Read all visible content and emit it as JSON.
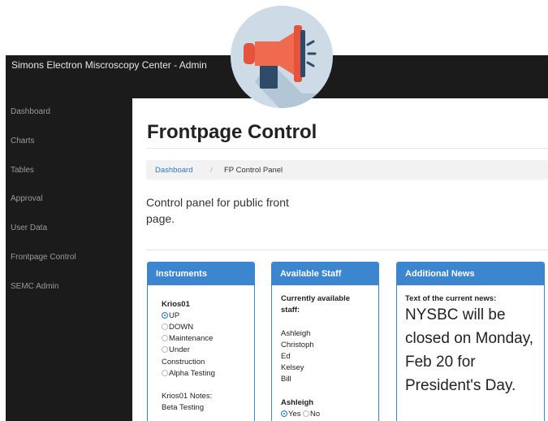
{
  "app": {
    "title": "Simons Electron Miscroscopy Center - Admin"
  },
  "logo": {
    "icon": "megaphone-icon",
    "colors": {
      "circle": "#cddbe6",
      "body": "#e5533d",
      "handle": "#2f4a66"
    }
  },
  "sidebar": {
    "items": [
      {
        "label": "Dashboard"
      },
      {
        "label": "Charts"
      },
      {
        "label": "Tables"
      },
      {
        "label": "Approval"
      },
      {
        "label": "User Data"
      },
      {
        "label": "Frontpage Control"
      },
      {
        "label": "SEMC Admin"
      }
    ]
  },
  "main": {
    "title": "Frontpage Control",
    "breadcrumb": {
      "link": "Dashboard",
      "separator": "/",
      "active": "FP Control Panel"
    },
    "lead": "Control panel for public front page."
  },
  "instruments": {
    "header": "Instruments",
    "instrument_name": "Krios01",
    "options": [
      "UP",
      "DOWN",
      "Maintenance",
      "Under",
      "Construction",
      "Alpha Testing"
    ],
    "selected": "UP",
    "notes_label": "Krios01 Notes:",
    "notes_value": "Beta Testing"
  },
  "staff": {
    "header": "Available Staff",
    "currently_label_line1": "Currently available",
    "currently_label_line2": "staff:",
    "names": [
      "Ashleigh",
      "Christoph",
      "Ed",
      "Kelsey",
      "Bill"
    ],
    "person_label": "Ashleigh",
    "yes_label": "Yes",
    "no_label": "No",
    "selected": "Yes"
  },
  "news": {
    "header": "Additional News",
    "current_label": "Text of the current news:",
    "text": "NYSBC will be closed on Monday, Feb 20 for President's Day."
  },
  "colors": {
    "accent": "#3c85cf",
    "dark": "#1b1b1b",
    "link": "#2b78c5"
  }
}
